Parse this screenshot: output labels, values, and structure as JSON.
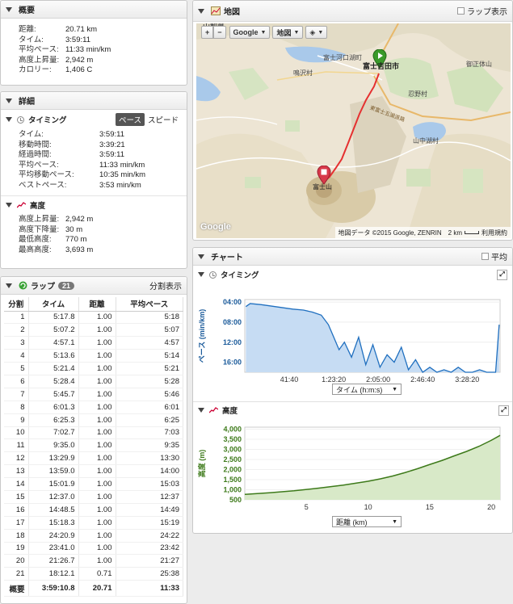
{
  "summary": {
    "title": "概要",
    "rows": [
      {
        "k": "距離:",
        "v": "20.71 km"
      },
      {
        "k": "タイム:",
        "v": "3:59:11"
      },
      {
        "k": "平均ペース:",
        "v": "11:33 min/km"
      },
      {
        "k": "高度上昇量:",
        "v": "2,942 m"
      },
      {
        "k": "カロリー:",
        "v": "1,406 C"
      }
    ]
  },
  "details": {
    "title": "詳細",
    "timing": {
      "title": "タイミング",
      "tab_pace": "ペース",
      "tab_speed": "スピード",
      "rows": [
        {
          "k": "タイム:",
          "v": "3:59:11"
        },
        {
          "k": "移動時間:",
          "v": "3:39:21"
        },
        {
          "k": "経過時間:",
          "v": "3:59:11"
        },
        {
          "k": "平均ペース:",
          "v": "11:33 min/km"
        },
        {
          "k": "平均移動ペース:",
          "v": "10:35 min/km"
        },
        {
          "k": "ベストペース:",
          "v": "3:53 min/km"
        }
      ]
    },
    "elevation": {
      "title": "高度",
      "rows": [
        {
          "k": "高度上昇量:",
          "v": "2,942 m"
        },
        {
          "k": "高度下降量:",
          "v": "30 m"
        },
        {
          "k": "最低高度:",
          "v": "770 m"
        },
        {
          "k": "最高高度:",
          "v": "3,693 m"
        }
      ]
    }
  },
  "laps": {
    "title": "ラップ",
    "count": "21",
    "split_view": "分割表示",
    "headers": [
      "分割",
      "タイム",
      "距離",
      "平均ペース"
    ],
    "rows": [
      [
        "1",
        "5:17.8",
        "1.00",
        "5:18"
      ],
      [
        "2",
        "5:07.2",
        "1.00",
        "5:07"
      ],
      [
        "3",
        "4:57.1",
        "1.00",
        "4:57"
      ],
      [
        "4",
        "5:13.6",
        "1.00",
        "5:14"
      ],
      [
        "5",
        "5:21.4",
        "1.00",
        "5:21"
      ],
      [
        "6",
        "5:28.4",
        "1.00",
        "5:28"
      ],
      [
        "7",
        "5:45.7",
        "1.00",
        "5:46"
      ],
      [
        "8",
        "6:01.3",
        "1.00",
        "6:01"
      ],
      [
        "9",
        "6:25.3",
        "1.00",
        "6:25"
      ],
      [
        "10",
        "7:02.7",
        "1.00",
        "7:03"
      ],
      [
        "11",
        "9:35.0",
        "1.00",
        "9:35"
      ],
      [
        "12",
        "13:29.9",
        "1.00",
        "13:30"
      ],
      [
        "13",
        "13:59.0",
        "1.00",
        "14:00"
      ],
      [
        "14",
        "15:01.9",
        "1.00",
        "15:03"
      ],
      [
        "15",
        "12:37.0",
        "1.00",
        "12:37"
      ],
      [
        "16",
        "14:48.5",
        "1.00",
        "14:49"
      ],
      [
        "17",
        "15:18.3",
        "1.00",
        "15:19"
      ],
      [
        "18",
        "24:20.9",
        "1.00",
        "24:22"
      ],
      [
        "19",
        "23:41.0",
        "1.00",
        "23:42"
      ],
      [
        "20",
        "21:26.7",
        "1.00",
        "21:27"
      ],
      [
        "21",
        "18:12.1",
        "0.71",
        "25:38"
      ]
    ],
    "total": [
      "概要",
      "3:59:10.8",
      "20.71",
      "11:33"
    ]
  },
  "map": {
    "title": "地図",
    "lap_display": "ラップ表示",
    "zoom_in": "+",
    "zoom_out": "−",
    "provider": "Google",
    "type": "地図",
    "labels": {
      "fujikawaguchiko": "富士河口湖町",
      "fujiyoshida": "富士吉田市",
      "narusawa": "鳴沢村",
      "oshino": "忍野村",
      "yamanakako": "山中湖村",
      "fuji": "富士山",
      "mitsutoge": "御正体山",
      "road": "東富士五湖道路",
      "top_left": "山梨県"
    },
    "attribution": "地図データ ©2015 Google, ZENRIN",
    "scale": "2 km",
    "terms": "利用規約",
    "logo": "Google"
  },
  "charts": {
    "title": "チャート",
    "avg": "平均",
    "timing_title": "タイミング",
    "timing_axis_select": "タイム (h:m:s)",
    "elev_title": "高度",
    "elev_axis_select": "距離 (km)"
  },
  "chart_data": [
    {
      "type": "area",
      "title": "タイミング",
      "ylabel": "ペース (min/km)",
      "xlabel": "タイム (h:m:s)",
      "x_ticks": [
        "41:40",
        "1:23:20",
        "2:05:00",
        "2:46:40",
        "3:28:20"
      ],
      "y_ticks": [
        "04:00",
        "08:00",
        "12:00",
        "16:00"
      ],
      "ylim": [
        18,
        3.5
      ],
      "xlim_seconds": [
        0,
        14351
      ],
      "x": [
        60,
        300,
        900,
        1500,
        2100,
        2700,
        3300,
        3800,
        4300,
        4700,
        5000,
        5300,
        5600,
        6000,
        6400,
        6800,
        7200,
        7600,
        8000,
        8400,
        8800,
        9200,
        9600,
        10000,
        10400,
        10800,
        11200,
        11600,
        12000,
        12400,
        12800,
        13200,
        13600,
        14100,
        14300
      ],
      "values": [
        4.9,
        4.3,
        4.5,
        4.8,
        5.1,
        5.4,
        5.6,
        6.0,
        6.6,
        8.5,
        11.0,
        13.5,
        12.0,
        15.0,
        11.0,
        16.5,
        12.5,
        17.0,
        14.5,
        16.0,
        13.0,
        17.5,
        15.5,
        18.0,
        17.0,
        18.0,
        17.5,
        18.0,
        17.0,
        18.0,
        18.0,
        17.5,
        18.0,
        18.0,
        8.5
      ]
    },
    {
      "type": "area",
      "title": "高度",
      "ylabel": "高度 (m)",
      "xlabel": "距離 (km)",
      "x_ticks": [
        5,
        10,
        15,
        20
      ],
      "y_ticks": [
        500,
        1000,
        1500,
        2000,
        2500,
        3000,
        3500,
        4000
      ],
      "ylim": [
        500,
        4100
      ],
      "xlim": [
        0,
        20.71
      ],
      "x": [
        0,
        2,
        4,
        6,
        8,
        10,
        11,
        12,
        13,
        14,
        15,
        16,
        17,
        18,
        19,
        20,
        20.71
      ],
      "values": [
        770,
        850,
        950,
        1080,
        1230,
        1420,
        1540,
        1680,
        1850,
        2040,
        2250,
        2450,
        2680,
        2900,
        3150,
        3450,
        3693
      ]
    }
  ],
  "colors": {
    "pace_line": "#1f6fbf",
    "pace_fill": "#c6dcf3",
    "elev_line": "#3d7a1a",
    "elev_fill": "#d8e9c8",
    "route": "#e53030",
    "start_marker": "#3a9a2a",
    "end_marker": "#d8394a"
  }
}
